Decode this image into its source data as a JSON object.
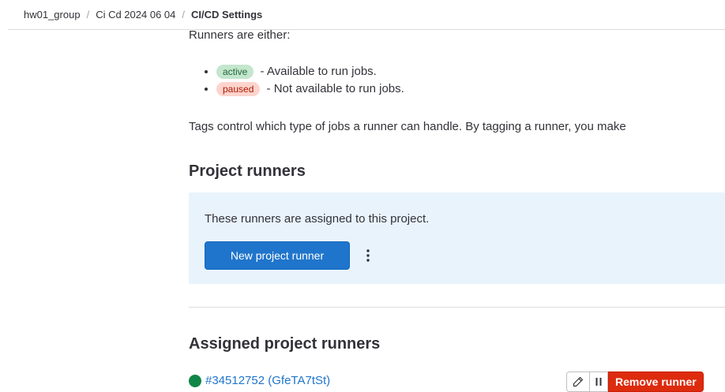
{
  "breadcrumb": {
    "items": [
      "hw01_group",
      "Ci Cd 2024 06 04",
      "CI/CD Settings"
    ],
    "separator": "/"
  },
  "intro": {
    "runners_are": "Runners are either:",
    "statuses": [
      {
        "badge": "active",
        "text": "- Available to run jobs."
      },
      {
        "badge": "paused",
        "text": "- Not available to run jobs."
      }
    ],
    "tags_text": "Tags control which type of jobs a runner can handle. By tagging a runner, you make"
  },
  "project_runners": {
    "heading": "Project runners",
    "info_text": "These runners are assigned to this project.",
    "new_button": "New project runner",
    "more_icon": "vertical-ellipsis-icon"
  },
  "assigned": {
    "heading": "Assigned project runners",
    "runner": {
      "id_label": "#34512752 (GfeTA7tSt)",
      "status_color": "#108548",
      "edit_icon": "pencil-icon",
      "pause_icon": "pause-icon",
      "remove_label": "Remove runner"
    }
  },
  "colors": {
    "primary": "#1f75cb",
    "danger": "#dd2b0e",
    "info_bg": "#e9f3fc",
    "active_badge_bg": "#c3e6cd",
    "paused_badge_bg": "#fdd4cd"
  }
}
